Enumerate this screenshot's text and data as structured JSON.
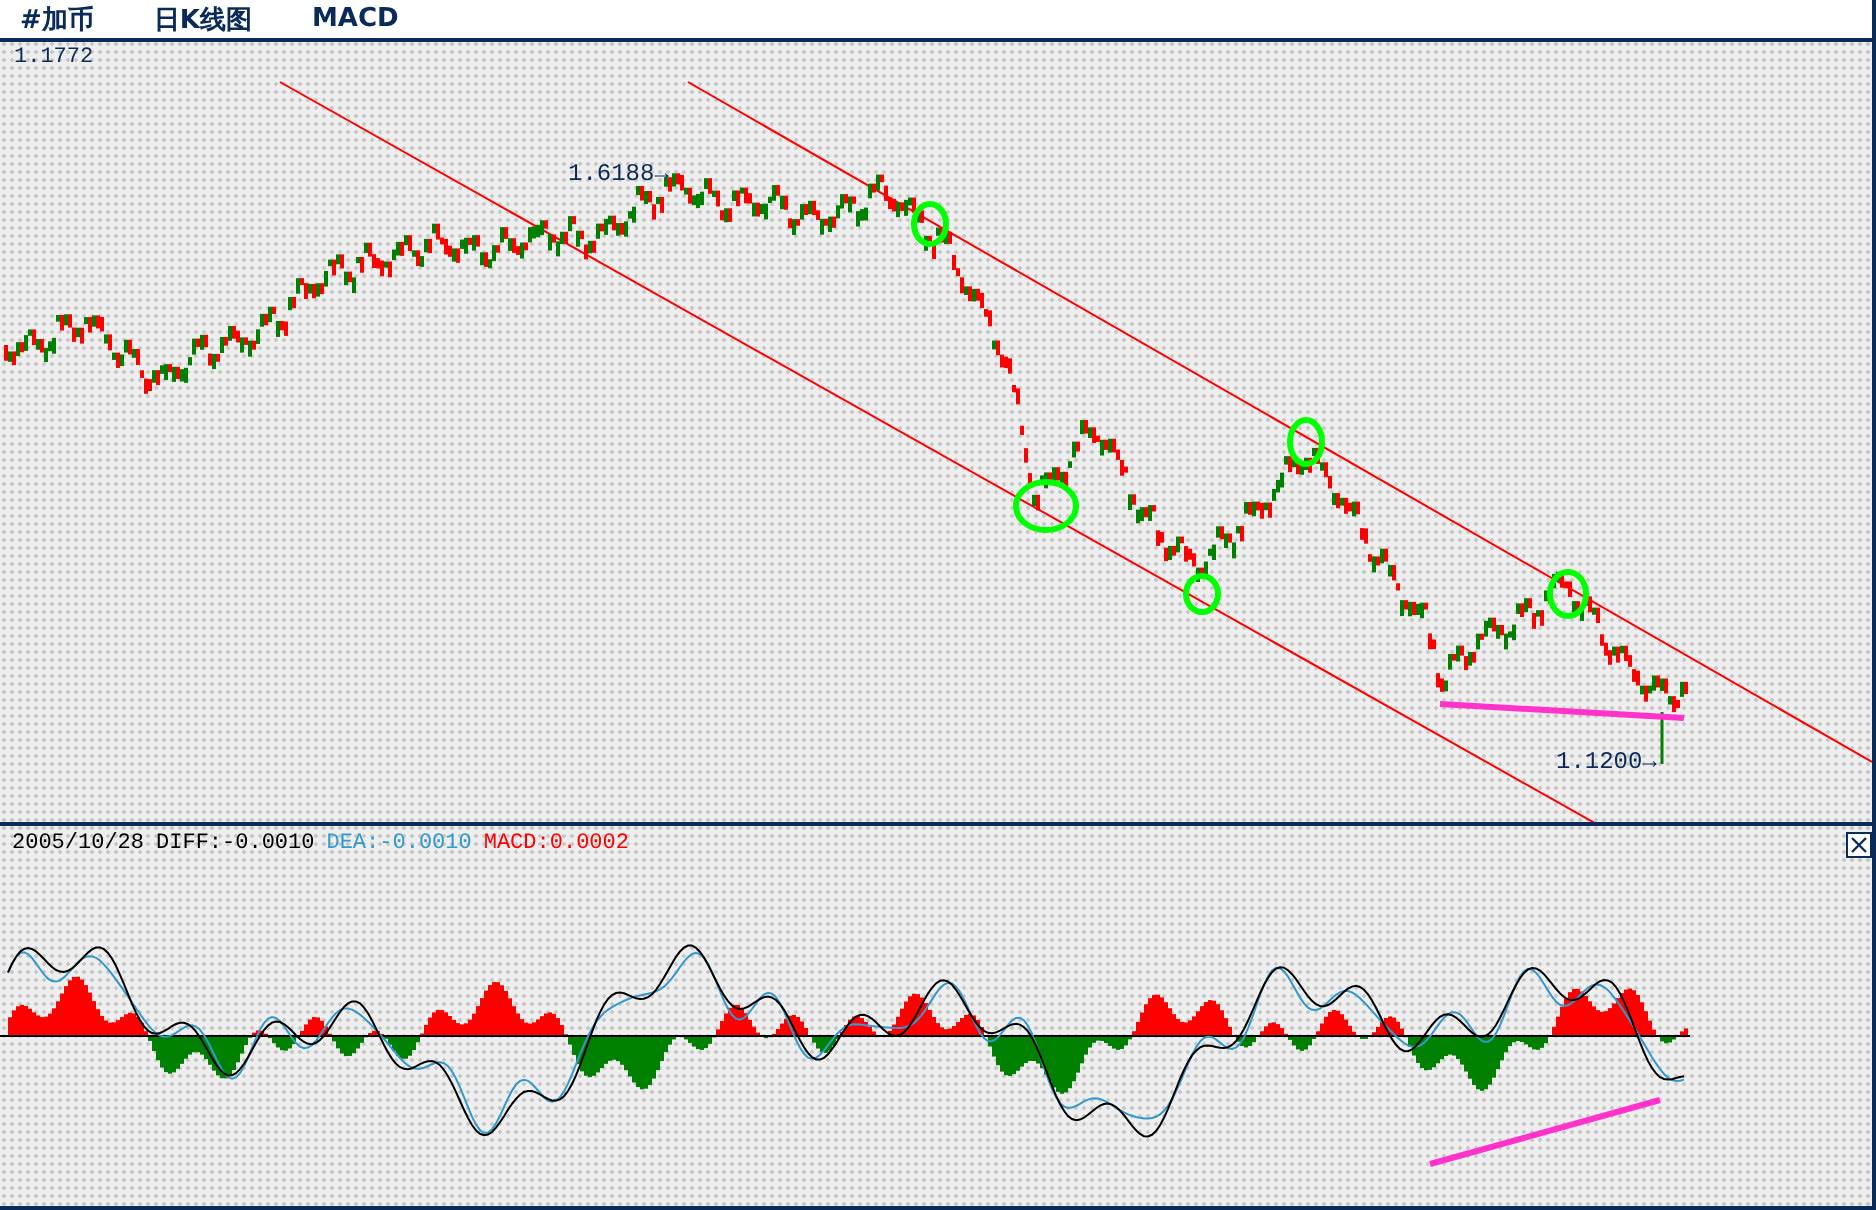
{
  "header": {
    "items": [
      "#加币",
      "日K线图",
      "MACD"
    ]
  },
  "price_panel": {
    "top_value": "1.1772",
    "annotations": [
      {
        "kind": "high",
        "text": "1.6188→"
      },
      {
        "kind": "low",
        "text": "1.1200→"
      }
    ]
  },
  "macd_panel": {
    "date": "2005/10/28",
    "diff": "DIFF:-0.0010",
    "dea": "DEA:-0.0010",
    "macd": "MACD:0.0002"
  }
}
